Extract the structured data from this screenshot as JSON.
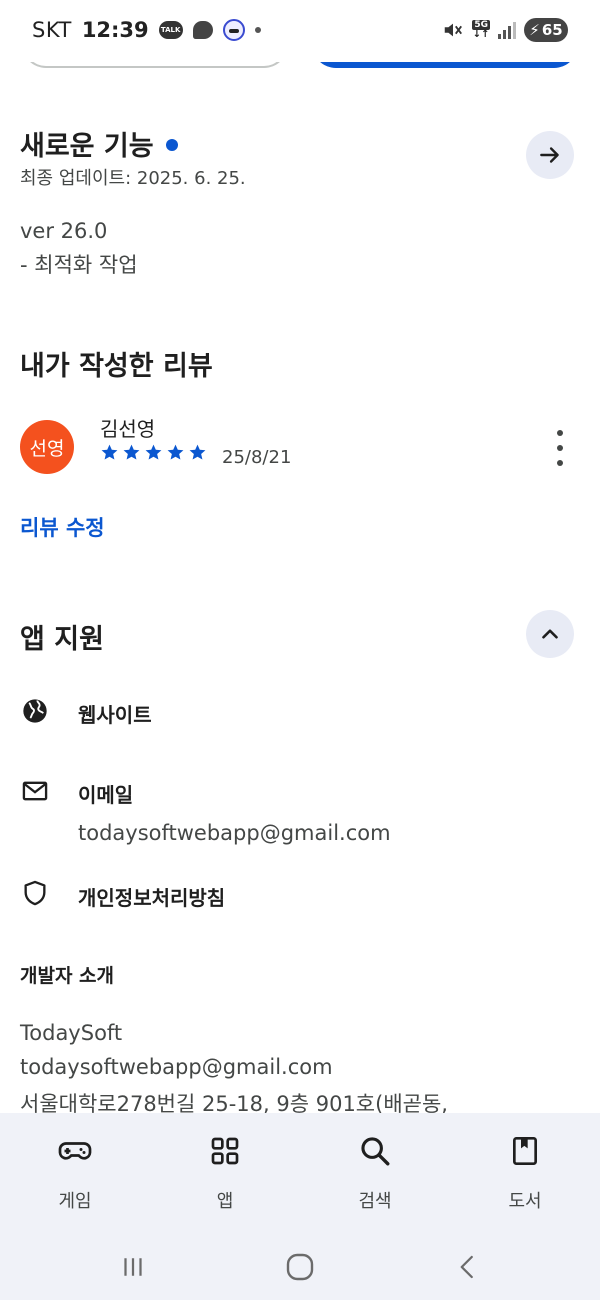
{
  "status_bar": {
    "carrier": "SKT",
    "time": "12:39",
    "talk_badge": "TALK",
    "network": "5G",
    "battery": "65"
  },
  "whats_new": {
    "title": "새로운 기능",
    "last_updated": "최종 업데이트: 2025. 6. 25.",
    "version": "ver 26.0",
    "notes": "- 최적화 작업"
  },
  "my_review": {
    "title": "내가 작성한 리뷰",
    "avatar_text": "선영",
    "reviewer_name": "김선영",
    "rating": 5,
    "rating_max": 5,
    "date": "25/8/21",
    "edit_label": "리뷰 수정"
  },
  "app_support": {
    "title": "앱 지원",
    "items": [
      {
        "label": "웹사이트",
        "icon": "globe-icon"
      },
      {
        "label": "이메일",
        "value": "todaysoftwebapp@gmail.com",
        "icon": "mail-icon"
      },
      {
        "label": "개인정보처리방침",
        "icon": "shield-icon"
      }
    ]
  },
  "developer": {
    "title": "개발자 소개",
    "name": "TodaySoft",
    "email": "todaysoftwebapp@gmail.com",
    "address": "서울대학로278번길 25-18, 9층 901호(배곧동,"
  },
  "bottom_nav": [
    {
      "label": "게임",
      "icon": "gamepad-icon"
    },
    {
      "label": "앱",
      "icon": "apps-grid-icon"
    },
    {
      "label": "검색",
      "icon": "search-icon"
    },
    {
      "label": "도서",
      "icon": "book-icon"
    }
  ],
  "colors": {
    "accent": "#0b57d0",
    "avatar": "#f4511e",
    "nav_bg": "#f0f2f8",
    "circle_btn": "#e8ebf5"
  }
}
